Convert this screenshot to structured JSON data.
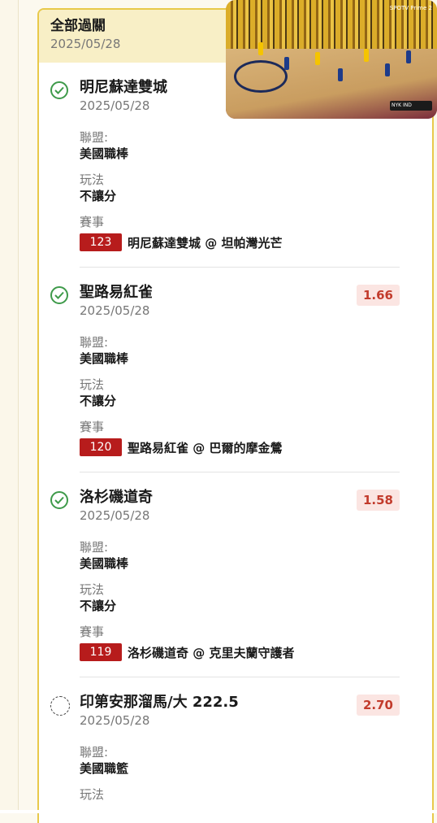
{
  "parlay": {
    "title": "全部過關",
    "date": "2025/05/28"
  },
  "labels": {
    "league": "聯盟:",
    "play": "玩法",
    "event": "賽事"
  },
  "items": [
    {
      "team": "明尼蘇達雙城",
      "date": "2025/05/28",
      "odds": "",
      "league": "美國職棒",
      "play": "不讓分",
      "event_no": "123",
      "event": "明尼蘇達雙城 @ 坦帕灣光芒",
      "status": "won"
    },
    {
      "team": "聖路易紅雀",
      "date": "2025/05/28",
      "odds": "1.66",
      "league": "美國職棒",
      "play": "不讓分",
      "event_no": "120",
      "event": "聖路易紅雀 @ 巴爾的摩金鶯",
      "status": "won"
    },
    {
      "team": "洛杉磯道奇",
      "date": "2025/05/28",
      "odds": "1.58",
      "league": "美國職棒",
      "play": "不讓分",
      "event_no": "119",
      "event": "洛杉磯道奇 @ 克里夫蘭守護者",
      "status": "won"
    },
    {
      "team": "印第安那溜馬/大 222.5",
      "date": "2025/05/28",
      "odds": "2.70",
      "league": "美國職籃",
      "play": "",
      "event_no": "",
      "event": "",
      "status": "pending"
    }
  ],
  "video": {
    "brand": "SPOTV Prime 2",
    "score_text": "NYK IND"
  },
  "colors": {
    "accent": "#e8c94a",
    "header_bg": "#f8efc6",
    "odds": "#c23b2c",
    "event_badge": "#b71c1c",
    "check": "#3e9a4a"
  }
}
